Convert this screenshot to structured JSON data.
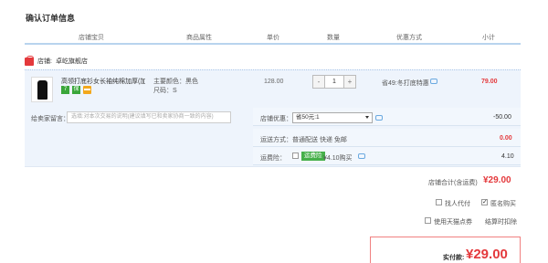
{
  "page": {
    "title": "确认订单信息"
  },
  "columns": [
    "店铺宝贝",
    "商品属性",
    "单价",
    "数量",
    "优惠方式",
    "小计"
  ],
  "shop": {
    "label": "店铺:",
    "name": "卓屹旗舰店"
  },
  "item": {
    "title": "高领打底衫女长袖纯棉加厚(加...",
    "badges": [
      "7",
      "保"
    ],
    "attr_color": "主要颜色：黑色",
    "attr_size": "尺码：S",
    "unit_price": "128.00",
    "qty_minus": "-",
    "quantity": "1",
    "qty_plus": "+",
    "promo": "省49:冬打底特惠",
    "subtotal": "79.00"
  },
  "message": {
    "label": "给卖家留言：",
    "placeholder": "选填:对本次交易的说明(建议填写已和卖家协商一致的内容)"
  },
  "shop_promo": {
    "label": "店铺优惠：",
    "selected": "省50元:1",
    "amount": "-50.00"
  },
  "shipping": {
    "label": "运送方式：",
    "value": "普通配送 快递 免邮",
    "amount": "0.00"
  },
  "insurance": {
    "label": "运费险：",
    "tag": "运费险",
    "value": "¥4.10购买",
    "amount": "4.10"
  },
  "shop_total": {
    "label": "店铺合计(含运费)",
    "amount": "¥29.00"
  },
  "options": {
    "proxy_pay": "找人代付",
    "anonymous": "匿名购买",
    "coupon": "使用天猫点券",
    "settle_time": "结算时扣除"
  },
  "payment": {
    "label": "实付款:",
    "amount": "¥29.00"
  },
  "colors": {
    "accent_red": "#e4393c",
    "row_bg": "#eef4fc",
    "green": "#46b04a"
  }
}
